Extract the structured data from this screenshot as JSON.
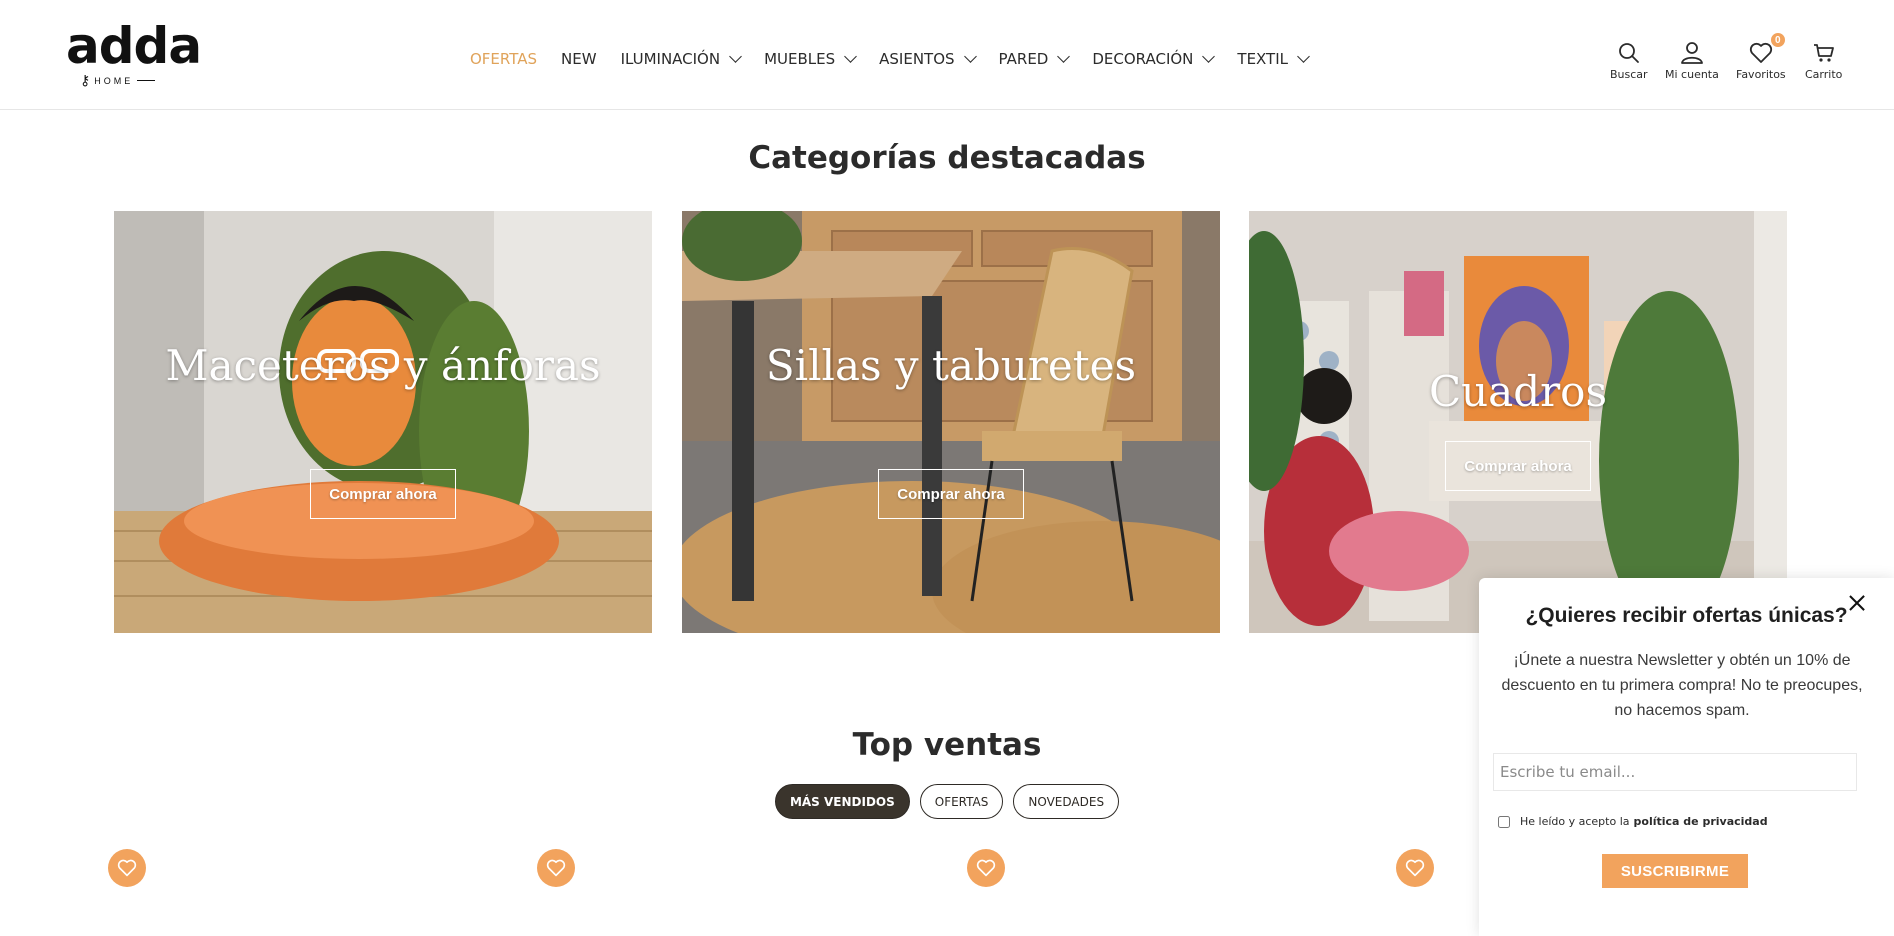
{
  "brand": {
    "name": "adda",
    "sub": "HOME"
  },
  "nav": {
    "items": [
      {
        "label": "OFERTAS",
        "active": true,
        "dropdown": false
      },
      {
        "label": "NEW",
        "active": false,
        "dropdown": false
      },
      {
        "label": "ILUMINACIÓN",
        "active": false,
        "dropdown": true
      },
      {
        "label": "MUEBLES",
        "active": false,
        "dropdown": true
      },
      {
        "label": "ASIENTOS",
        "active": false,
        "dropdown": true
      },
      {
        "label": "PARED",
        "active": false,
        "dropdown": true
      },
      {
        "label": "DECORACIÓN",
        "active": false,
        "dropdown": true
      },
      {
        "label": "TEXTIL",
        "active": false,
        "dropdown": true
      }
    ]
  },
  "utility": {
    "search": "Buscar",
    "account": "Mi cuenta",
    "favorites": "Favoritos",
    "favorites_count": "0",
    "cart": "Carrito"
  },
  "featured": {
    "title": "Categorías destacadas",
    "cards": [
      {
        "title": "Maceteros y ánforas",
        "button": "Comprar ahora"
      },
      {
        "title": "Sillas y taburetes",
        "button": "Comprar ahora"
      },
      {
        "title": "Cuadros",
        "button": "Comprar ahora"
      }
    ]
  },
  "top_sales": {
    "title": "Top ventas",
    "tabs": [
      {
        "label": "MÁS VENDIDOS",
        "active": true
      },
      {
        "label": "OFERTAS",
        "active": false
      },
      {
        "label": "NOVEDADES",
        "active": false
      }
    ]
  },
  "newsletter": {
    "title": "¿Quieres recibir ofertas únicas?",
    "text": "¡Únete a nuestra Newsletter y obtén un 10% de descuento en tu primera compra! No te preocupes, no hacemos spam.",
    "email_placeholder": "Escribe tu email...",
    "consent_prefix": "He leído y acepto la",
    "consent_link": "política de privacidad",
    "submit": "SUSCRIBIRME"
  },
  "colors": {
    "accent": "#f2a35d",
    "nav_active": "#e0a35a",
    "tab_active": "#3a342c"
  }
}
